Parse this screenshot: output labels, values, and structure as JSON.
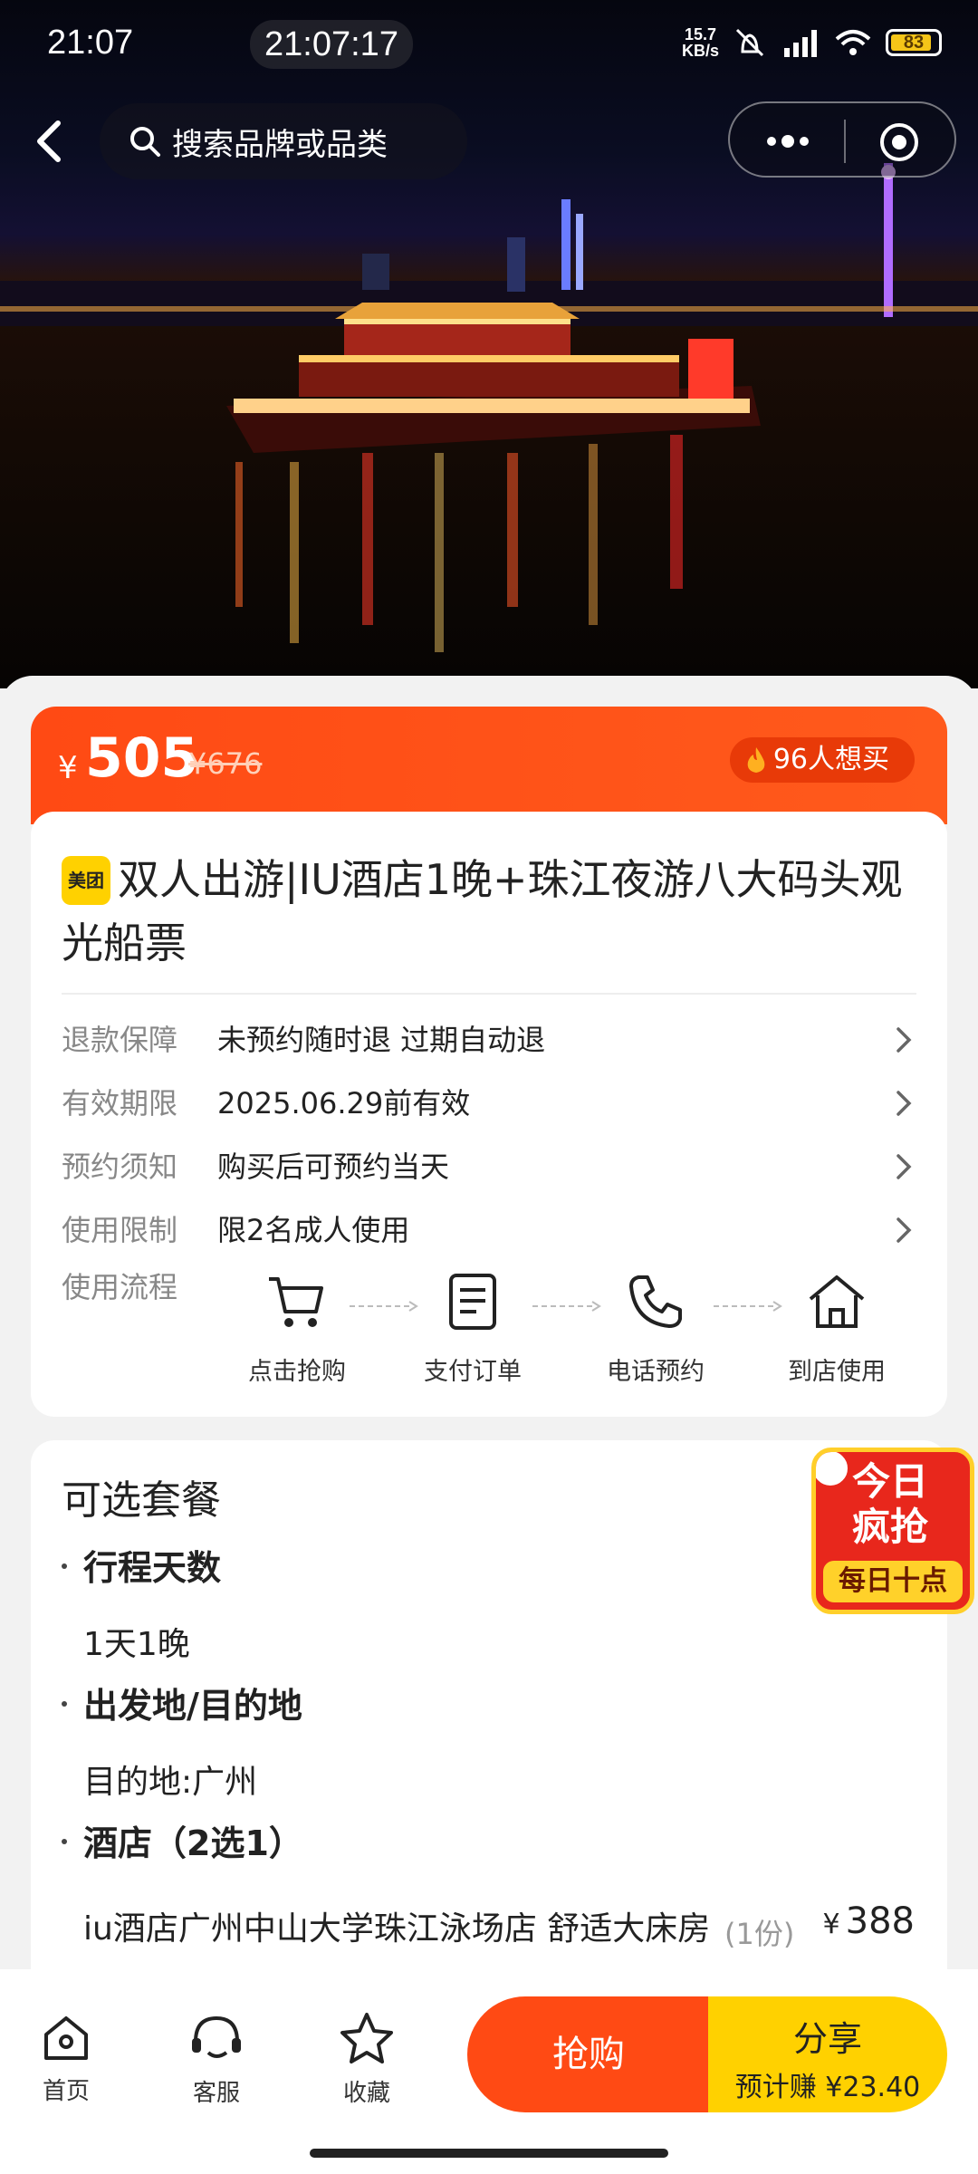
{
  "status_bar": {
    "time": "21:07",
    "clock": "21:07:17",
    "net_speed_value": "15.7",
    "net_speed_unit": "KB/s",
    "battery": "83"
  },
  "top_nav": {
    "search_placeholder": "搜索品牌或品类"
  },
  "price": {
    "currency": "¥",
    "current": "505",
    "original": "¥676",
    "want_count": "96人想买"
  },
  "product": {
    "badge": "美团",
    "title": "双人出游|IU酒店1晚+珠江夜游八大码头观光船票"
  },
  "info_rows": [
    {
      "key": "退款保障",
      "value": "未预约随时退 过期自动退"
    },
    {
      "key": "有效期限",
      "value": "2025.06.29前有效"
    },
    {
      "key": "预约须知",
      "value": "购买后可预约当天"
    },
    {
      "key": "使用限制",
      "value": "限2名成人使用"
    }
  ],
  "flow": {
    "label": "使用流程",
    "steps": [
      {
        "label": "点击抢购",
        "icon": "cart-icon"
      },
      {
        "label": "支付订单",
        "icon": "document-icon"
      },
      {
        "label": "电话预约",
        "icon": "phone-icon"
      },
      {
        "label": "到店使用",
        "icon": "house-icon"
      }
    ]
  },
  "options": {
    "title": "可选套餐",
    "sections": [
      {
        "heading": "行程天数",
        "value": "1天1晚"
      },
      {
        "heading": "出发地/目的地",
        "value": "目的地:广州"
      },
      {
        "heading": "酒店（2选1）",
        "value": ""
      }
    ],
    "hotel": {
      "name": "iu酒店广州中山大学珠江泳场店 舒适大床房",
      "qty": "(1份)",
      "currency": "¥",
      "price": "388"
    }
  },
  "promo": {
    "line1": "今日",
    "line2": "疯抢",
    "line3": "每日十点"
  },
  "bottom_bar": {
    "tabs": [
      {
        "label": "首页",
        "icon": "home-icon"
      },
      {
        "label": "客服",
        "icon": "headset-icon"
      },
      {
        "label": "收藏",
        "icon": "star-icon"
      }
    ],
    "buy_label": "抢购",
    "share_label": "分享",
    "share_earn": "预计赚 ¥23.40"
  },
  "colors": {
    "accent": "#ff4a14",
    "share": "#ffd100",
    "promo_red": "#e8271c"
  }
}
